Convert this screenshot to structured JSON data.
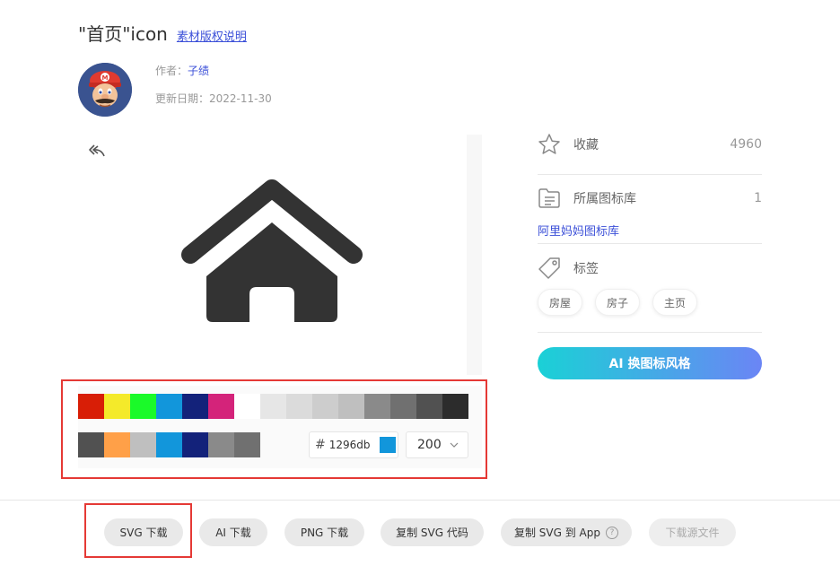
{
  "header": {
    "title": "\"首页\"icon",
    "license_link": "素材版权说明"
  },
  "meta": {
    "author_label": "作者：",
    "author_name": "子绩",
    "date_label": "更新日期：",
    "date_value": "2022-11-30"
  },
  "palette": {
    "row1": [
      "#d81e06",
      "#f4ea2a",
      "#1afa29",
      "#1296db",
      "#13227a",
      "#d4237a",
      "#ffffff",
      "#e6e6e6",
      "#dbdbdb",
      "#cdcdcd",
      "#bfbfbf",
      "#8a8a8a",
      "#707070",
      "#515151",
      "#2c2c2c"
    ],
    "row2": [
      "#515151",
      "#ffa048",
      "#bfbfbf",
      "#1296db",
      "#13227a",
      "#8a8a8a",
      "#707070"
    ],
    "hex_symbol": "#",
    "hex_value": "1296db",
    "selected_color": "#1296db",
    "size_value": "200"
  },
  "icon": {
    "fill_color": "#333333"
  },
  "sidebar": {
    "favorites_label": "收藏",
    "favorites_count": "4960",
    "library_label": "所属图标库",
    "library_count": "1",
    "library_link": "阿里妈妈图标库",
    "tags_label": "标签",
    "tags": [
      "房屋",
      "房子",
      "主页"
    ],
    "ai_button": "AI 换图标风格"
  },
  "actions": {
    "svg_download": "SVG 下载",
    "ai_download": "AI 下载",
    "png_download": "PNG 下载",
    "copy_svg_code": "复制 SVG 代码",
    "copy_svg_app": "复制 SVG 到 App",
    "help_symbol": "?",
    "download_source": "下载源文件"
  }
}
